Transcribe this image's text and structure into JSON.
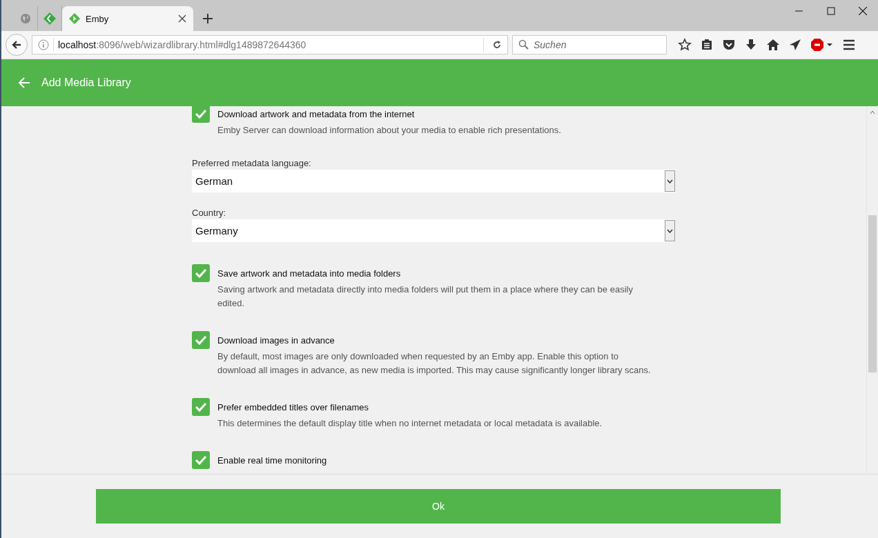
{
  "browser": {
    "tabs": [
      {
        "kind": "pinned",
        "selected": false
      },
      {
        "kind": "pinned-app",
        "selected": false
      },
      {
        "kind": "tab",
        "title": "Emby",
        "selected": true
      }
    ],
    "url_host": "localhost",
    "url_path": ":8096/web/wizardlibrary.html#dlg1489872644360",
    "search": {
      "placeholder": "Suchen"
    }
  },
  "header": {
    "title": "Add Media Library"
  },
  "settings": [
    {
      "kind": "checkbox",
      "label": "Download artwork and metadata from the internet",
      "checked": true,
      "description": "Emby Server can download information about your media to enable rich presentations."
    },
    {
      "kind": "select",
      "label": "Preferred metadata language:",
      "value": "German"
    },
    {
      "kind": "select",
      "label": "Country:",
      "value": "Germany"
    },
    {
      "kind": "checkbox",
      "label": "Save artwork and metadata into media folders",
      "checked": true,
      "description": "Saving artwork and metadata directly into media folders will put them in a place where they can be easily edited."
    },
    {
      "kind": "checkbox",
      "label": "Download images in advance",
      "checked": true,
      "description": "By default, most images are only downloaded when requested by an Emby app. Enable this option to download all images in advance, as new media is imported. This may cause significantly longer library scans."
    },
    {
      "kind": "checkbox",
      "label": "Prefer embedded titles over filenames",
      "checked": true,
      "description": "This determines the default display title when no internet metadata or local metadata is available."
    },
    {
      "kind": "checkbox",
      "label": "Enable real time monitoring",
      "checked": true
    }
  ],
  "footer": {
    "button": "Ok"
  }
}
